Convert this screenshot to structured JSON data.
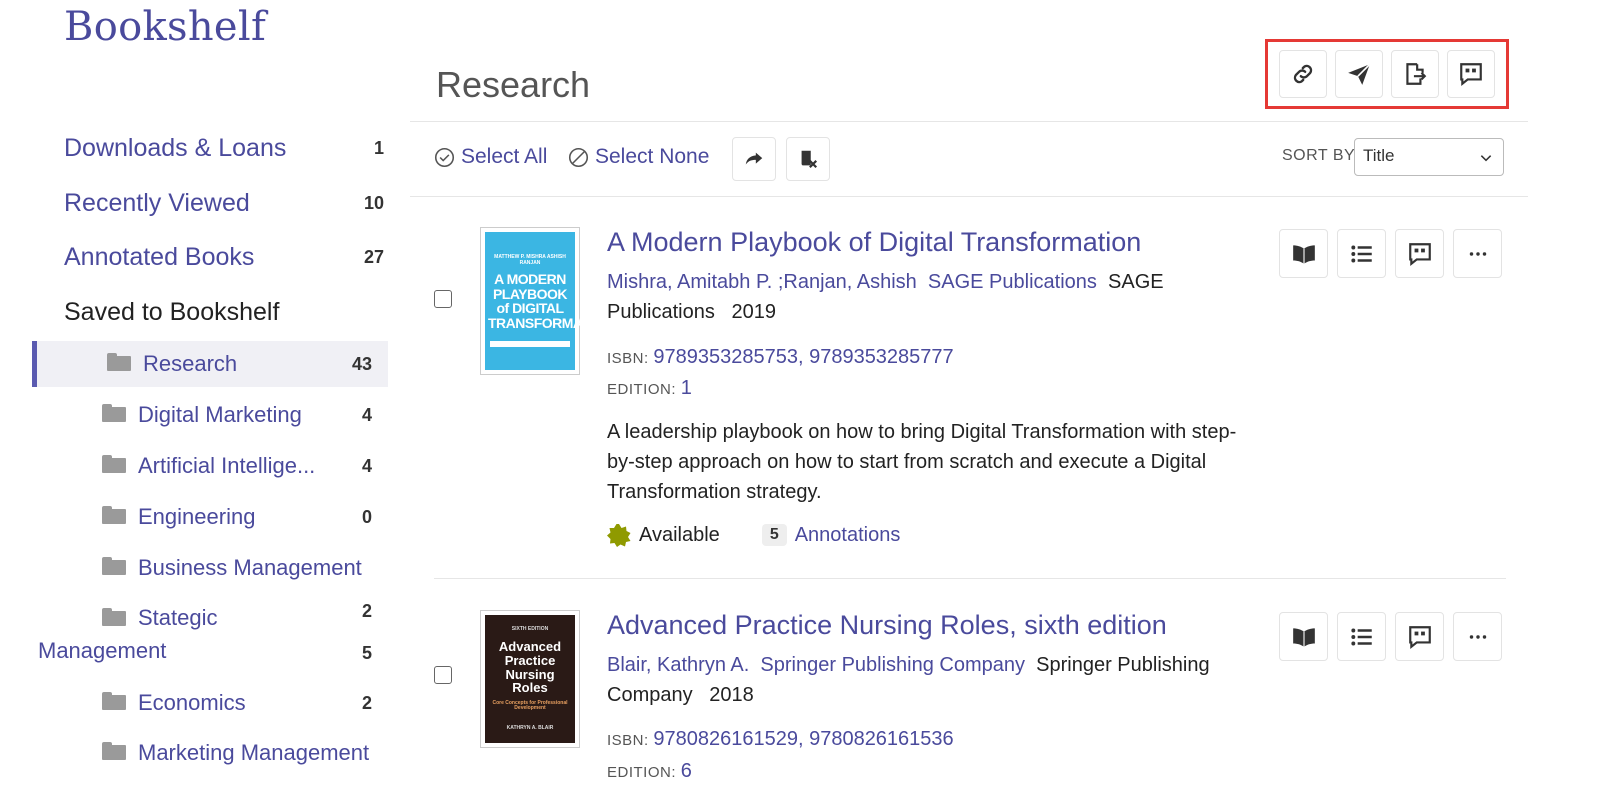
{
  "app": {
    "brand": "Bookshelf"
  },
  "sidebar": {
    "top_items": [
      {
        "label": "Downloads & Loans",
        "count": "1"
      },
      {
        "label": "Recently Viewed",
        "count": "10"
      },
      {
        "label": "Annotated Books",
        "count": "27"
      }
    ],
    "saved_label": "Saved to Bookshelf",
    "folders": [
      {
        "label": "Research",
        "count": "43"
      },
      {
        "label": "Digital Marketing",
        "count": "4"
      },
      {
        "label": "Artificial Intellige...",
        "count": "4"
      },
      {
        "label": "Engineering",
        "count": "0"
      },
      {
        "label": "Business Management",
        "count": "2"
      },
      {
        "label": "Stategic",
        "label2": "Management",
        "count": "5"
      },
      {
        "label": "Economics",
        "count": "2"
      },
      {
        "label": "Marketing Management",
        "count": ""
      }
    ]
  },
  "main": {
    "title": "Research",
    "toolbar": {
      "select_all": "Select All",
      "select_none": "Select None",
      "sort_label": "SORT BY",
      "sort_value": "Title"
    },
    "results": [
      {
        "title": "A Modern Playbook of Digital Transformation",
        "authors": "Mishra, Amitabh P. ;Ranjan, Ashish",
        "publisher_link": "SAGE Publications",
        "publisher": "SAGE",
        "publisher_cont": "Publications",
        "year": "2019",
        "isbn_label": "ISBN:",
        "isbn": "9789353285753, 9789353285777",
        "edition_label": "EDITION:",
        "edition": "1",
        "description": "A leadership playbook on how to bring Digital Transformation with step-by-step approach on how to start from scratch and execute a Digital Transformation strategy.",
        "status": "Available",
        "annotation_count": "5",
        "annotation_label": "Annotations",
        "cover_text": "A MODERN PLAYBOOK of DIGITAL TRANSFORMATION",
        "cover_top": "MATTHEW P. MISHRA\nASHISH RANJAN"
      },
      {
        "title": "Advanced Practice Nursing Roles, sixth edition",
        "authors": "Blair, Kathryn A.",
        "publisher_link": "Springer Publishing Company",
        "publisher": "Springer Publishing",
        "publisher_cont": "Company",
        "year": "2018",
        "isbn_label": "ISBN:",
        "isbn": "9780826161529, 9780826161536",
        "edition_label": "EDITION:",
        "edition": "6",
        "cover_text": "Advanced Practice Nursing Roles",
        "cover_sub": "Core Concepts for Professional Development",
        "cover_top": "SIXTH EDITION",
        "cover_author": "KATHRYN A. BLAIR"
      }
    ]
  },
  "colors": {
    "accent": "#4a4a9c",
    "highlight_border": "#e53935",
    "available": "#8f9a00"
  }
}
